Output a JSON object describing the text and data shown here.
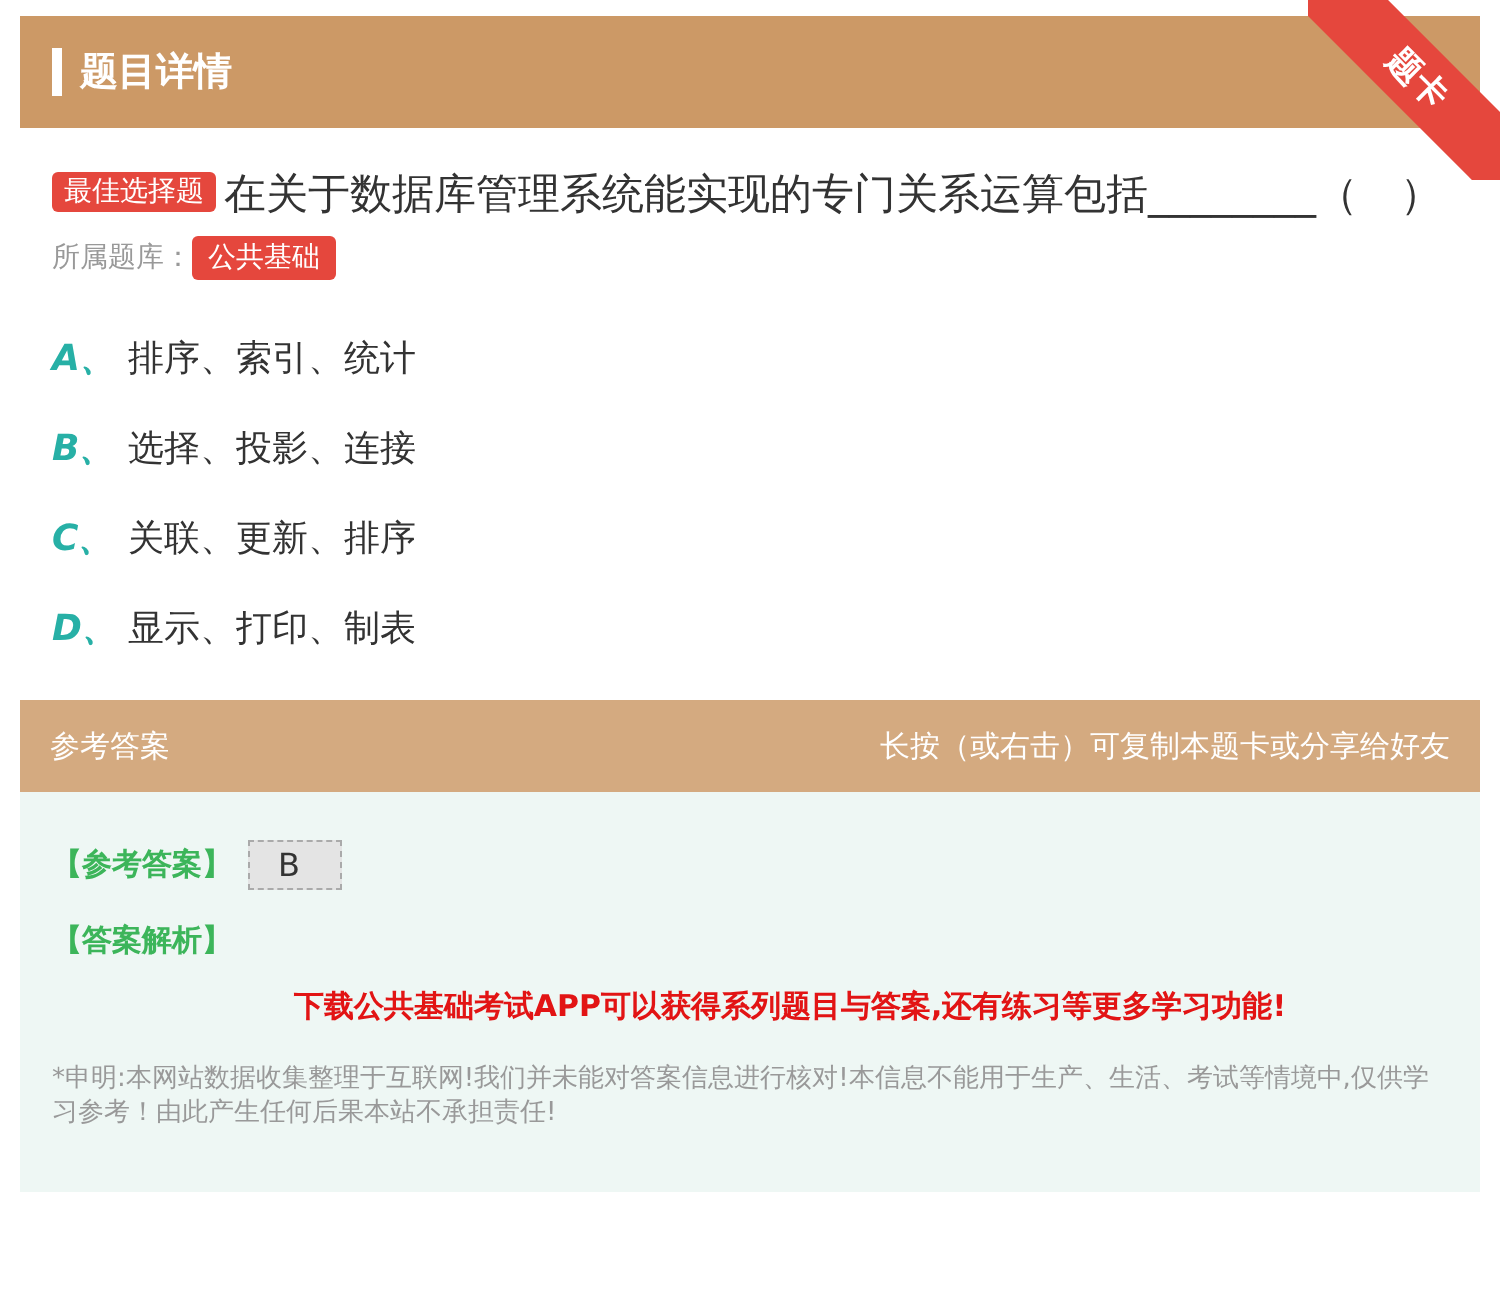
{
  "header": {
    "title": "题目详情",
    "ribbon": "题卡"
  },
  "question": {
    "type_badge": "最佳选择题",
    "text": "在关于数据库管理系统能实现的专门关系运算包括________（　）",
    "bank_label": "所属题库：",
    "bank": "公共基础"
  },
  "options": [
    {
      "letter": "A、",
      "text": "排序、索引、统计"
    },
    {
      "letter": "B、",
      "text": "选择、投影、连接"
    },
    {
      "letter": "C、",
      "text": "关联、更新、排序"
    },
    {
      "letter": "D、",
      "text": "显示、打印、制表"
    }
  ],
  "answer_bar": {
    "title": "参考答案",
    "hint": "长按（或右击）可复制本题卡或分享给好友"
  },
  "answer": {
    "label": "【参考答案】",
    "value": "B",
    "analysis_label": "【答案解析】",
    "promo": "下载公共基础考试APP可以获得系列题目与答案,还有练习等更多学习功能!",
    "disclaimer": "*申明:本网站数据收集整理于互联网!我们并未能对答案信息进行核对!本信息不能用于生产、生活、考试等情境中,仅供学习参考！由此产生任何后果本站不承担责任!"
  }
}
